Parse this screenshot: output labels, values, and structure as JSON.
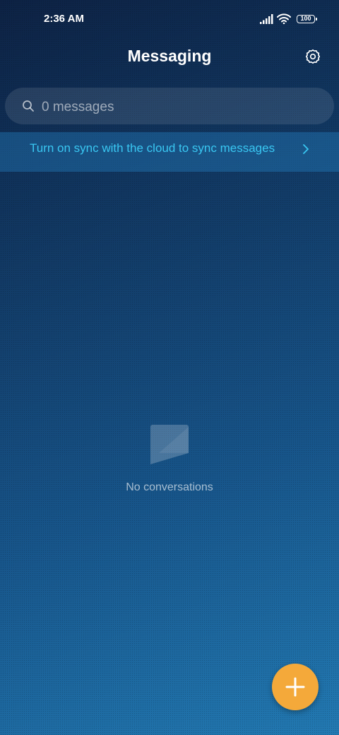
{
  "status_bar": {
    "time": "2:36 AM",
    "battery": "100",
    "icons": [
      "signal-icon",
      "wifi-icon",
      "battery-icon"
    ]
  },
  "header": {
    "title": "Messaging",
    "settings_icon": "gear-icon"
  },
  "search": {
    "placeholder": "0 messages",
    "icon": "search-icon"
  },
  "sync_banner": {
    "text": "Turn on sync with the cloud to sync messages",
    "icon": "chevron-right-icon",
    "color": "#39c7f2"
  },
  "empty_state": {
    "icon": "message-bubble-icon",
    "text": "No conversations"
  },
  "fab": {
    "icon": "plus-icon",
    "color": "#f4a93a"
  }
}
